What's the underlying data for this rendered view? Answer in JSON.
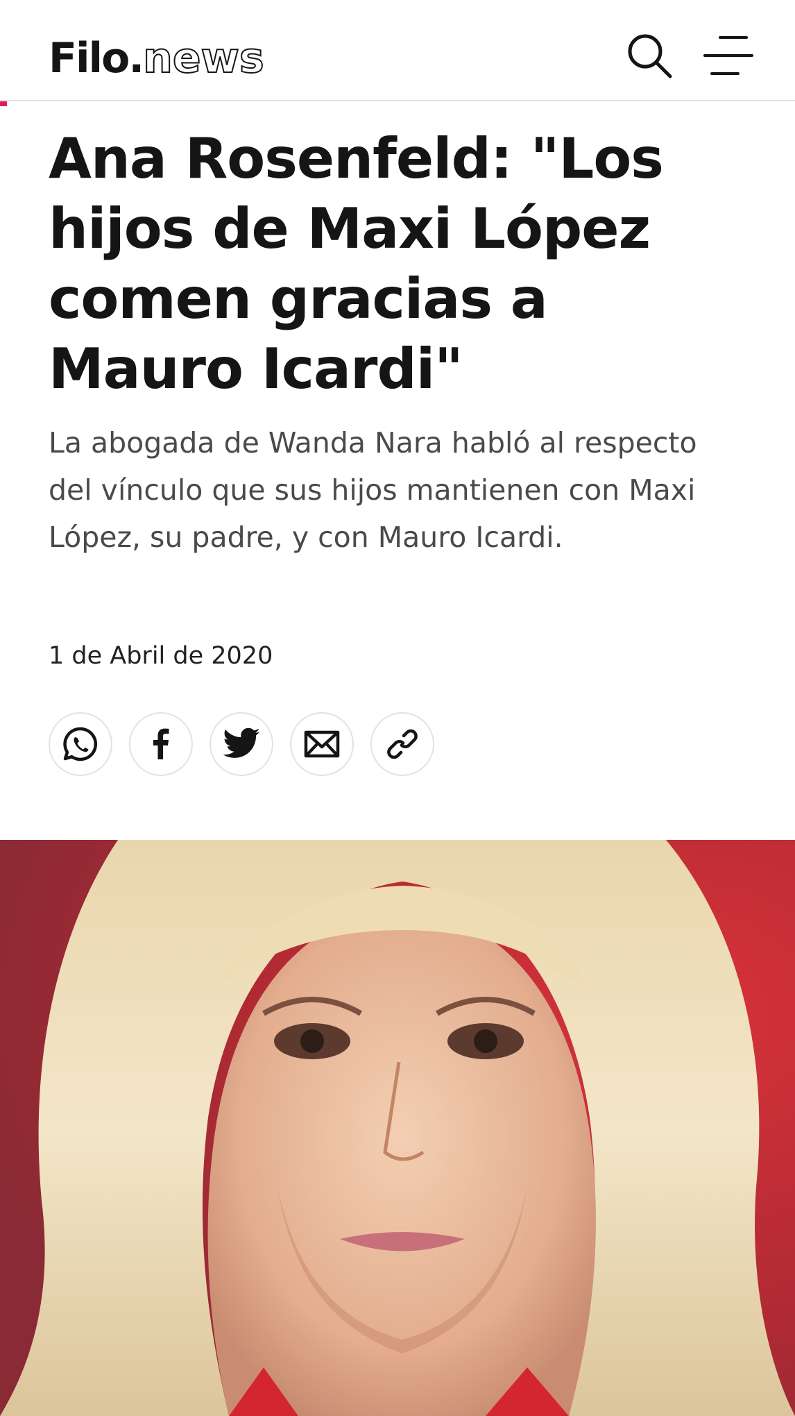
{
  "header": {
    "logo_bold": "Filo.",
    "logo_outline": "news",
    "search_icon": "search-icon",
    "menu_icon": "hamburger-menu-icon"
  },
  "article": {
    "title": "Ana Rosenfeld: \"Los hijos de Maxi López comen gracias a Mauro Icardi\"",
    "subtitle": "La abogada de Wanda Nara habló al respecto del vínculo que sus hijos mantienen con Maxi López, su padre, y con Mauro Icardi.",
    "date": "1 de Abril de 2020"
  },
  "share": {
    "buttons": [
      {
        "icon": "whatsapp-icon"
      },
      {
        "icon": "facebook-icon"
      },
      {
        "icon": "twitter-icon"
      },
      {
        "icon": "email-icon"
      },
      {
        "icon": "link-icon"
      }
    ]
  },
  "colors": {
    "accent": "#e6185b",
    "text": "#151515",
    "subtitle": "#4a4a4a",
    "photo_background": "#b82a33"
  }
}
